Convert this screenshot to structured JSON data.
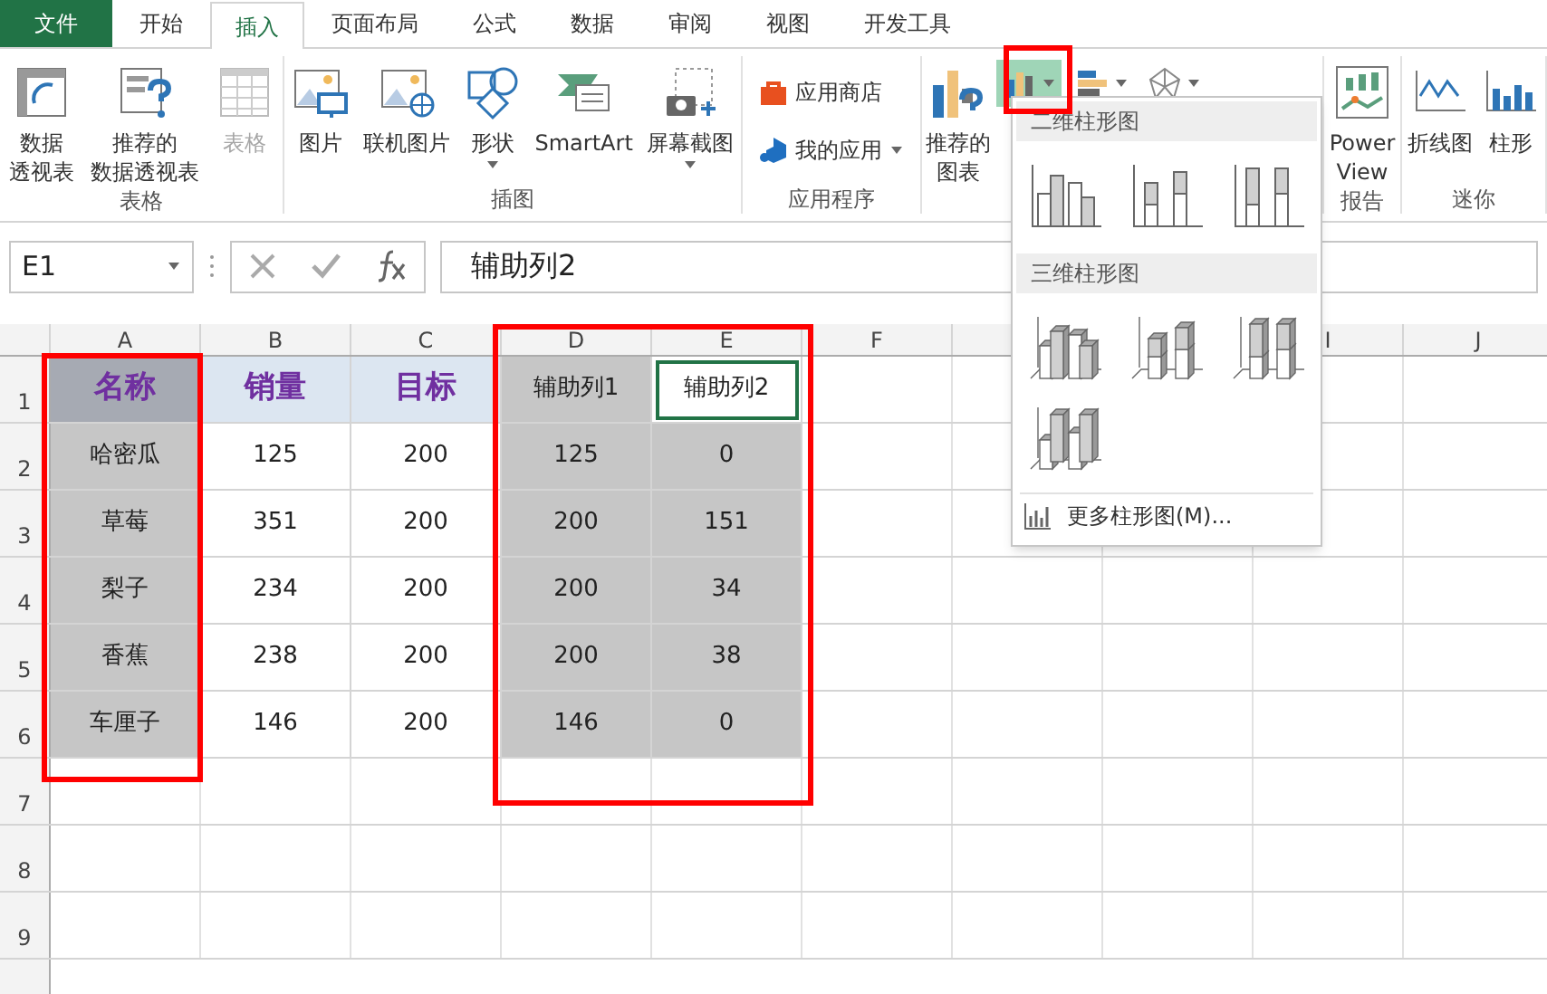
{
  "tabs": [
    {
      "label": "文件",
      "kind": "file",
      "selected": false
    },
    {
      "label": "开始",
      "kind": "tab",
      "selected": false
    },
    {
      "label": "插入",
      "kind": "tab",
      "selected": true
    },
    {
      "label": "页面布局",
      "kind": "tab",
      "selected": false
    },
    {
      "label": "公式",
      "kind": "tab",
      "selected": false
    },
    {
      "label": "数据",
      "kind": "tab",
      "selected": false
    },
    {
      "label": "审阅",
      "kind": "tab",
      "selected": false
    },
    {
      "label": "视图",
      "kind": "tab",
      "selected": false
    },
    {
      "label": "开发工具",
      "kind": "tab",
      "selected": false
    }
  ],
  "ribbon": [
    {
      "label": "表格",
      "buttons": [
        {
          "kind": "large",
          "lines": [
            "数据",
            "透视表"
          ],
          "disabled": false,
          "dropdown": false
        },
        {
          "kind": "large",
          "lines": [
            "推荐的",
            "数据透视表"
          ],
          "disabled": false,
          "dropdown": false
        },
        {
          "kind": "large",
          "lines": [
            "表格"
          ],
          "disabled": true,
          "dropdown": false
        }
      ]
    },
    {
      "label": "插图",
      "buttons": [
        {
          "kind": "large",
          "lines": [
            "图片"
          ],
          "disabled": false,
          "dropdown": false
        },
        {
          "kind": "large",
          "lines": [
            "联机图片"
          ],
          "disabled": false,
          "dropdown": false
        },
        {
          "kind": "large",
          "lines": [
            "形状"
          ],
          "disabled": false,
          "dropdown": true
        },
        {
          "kind": "large",
          "lines": [
            "SmartArt"
          ],
          "disabled": false,
          "dropdown": false
        },
        {
          "kind": "large",
          "lines": [
            "屏幕截图"
          ],
          "disabled": false,
          "dropdown": true
        }
      ]
    },
    {
      "label": "应用程序",
      "buttons": [
        {
          "kind": "small",
          "lines": [
            "应用商店"
          ],
          "disabled": false,
          "dropdown": false
        },
        {
          "kind": "small",
          "lines": [
            "我的应用"
          ],
          "disabled": false,
          "dropdown": true
        }
      ]
    },
    {
      "buttons": [
        {
          "kind": "large",
          "lines": [
            "推荐的",
            "图表"
          ],
          "disabled": false,
          "dropdown": false
        },
        {
          "kind": "chartbar",
          "disabled": false,
          "dropdown": true
        },
        {
          "kind": "chartbar",
          "disabled": false,
          "dropdown": true
        },
        {
          "kind": "chartbar",
          "disabled": false,
          "dropdown": true
        }
      ]
    },
    {
      "label": "报告",
      "buttons": [
        {
          "kind": "large",
          "lines": [
            "Power",
            "View"
          ],
          "disabled": false,
          "dropdown": false
        }
      ]
    },
    {
      "label": "迷你",
      "buttons": [
        {
          "kind": "large",
          "lines": [
            "折线图"
          ],
          "disabled": false,
          "dropdown": false
        },
        {
          "kind": "large",
          "lines": [
            "柱形"
          ],
          "disabled": false,
          "dropdown": false
        }
      ]
    }
  ],
  "name_box": "E1",
  "formula": "辅助列2",
  "columns": [
    "A",
    "B",
    "C",
    "D",
    "E",
    "F",
    "I",
    "J"
  ],
  "rows": [
    {
      "label": "1",
      "cells": [
        {
          "text": "名称",
          "kind": "header-gray",
          "selected": false
        },
        {
          "text": "销量",
          "kind": "header-blue",
          "selected": false
        },
        {
          "text": "目标",
          "kind": "header-blue",
          "selected": false
        },
        {
          "text": "辅助列1",
          "kind": "shaded",
          "selected": false
        },
        {
          "text": "辅助列2",
          "kind": "plain",
          "selected": true
        }
      ]
    },
    {
      "label": "2",
      "cells": [
        {
          "text": "哈密瓜",
          "kind": "shaded",
          "selected": false
        },
        {
          "text": "125",
          "kind": "plain",
          "selected": false
        },
        {
          "text": "200",
          "kind": "plain",
          "selected": false
        },
        {
          "text": "125",
          "kind": "shaded",
          "selected": false
        },
        {
          "text": "0",
          "kind": "shaded",
          "selected": false
        }
      ]
    },
    {
      "label": "3",
      "cells": [
        {
          "text": "草莓",
          "kind": "shaded",
          "selected": false
        },
        {
          "text": "351",
          "kind": "plain",
          "selected": false
        },
        {
          "text": "200",
          "kind": "plain",
          "selected": false
        },
        {
          "text": "200",
          "kind": "shaded",
          "selected": false
        },
        {
          "text": "151",
          "kind": "shaded",
          "selected": false
        }
      ]
    },
    {
      "label": "4",
      "cells": [
        {
          "text": "梨子",
          "kind": "shaded",
          "selected": false
        },
        {
          "text": "234",
          "kind": "plain",
          "selected": false
        },
        {
          "text": "200",
          "kind": "plain",
          "selected": false
        },
        {
          "text": "200",
          "kind": "shaded",
          "selected": false
        },
        {
          "text": "34",
          "kind": "shaded",
          "selected": false
        }
      ]
    },
    {
      "label": "5",
      "cells": [
        {
          "text": "香蕉",
          "kind": "shaded",
          "selected": false
        },
        {
          "text": "238",
          "kind": "plain",
          "selected": false
        },
        {
          "text": "200",
          "kind": "plain",
          "selected": false
        },
        {
          "text": "200",
          "kind": "shaded",
          "selected": false
        },
        {
          "text": "38",
          "kind": "shaded",
          "selected": false
        }
      ]
    },
    {
      "label": "6",
      "cells": [
        {
          "text": "车厘子",
          "kind": "shaded",
          "selected": false
        },
        {
          "text": "146",
          "kind": "plain",
          "selected": false
        },
        {
          "text": "200",
          "kind": "plain",
          "selected": false
        },
        {
          "text": "146",
          "kind": "shaded",
          "selected": false
        },
        {
          "text": "0",
          "kind": "shaded",
          "selected": false
        }
      ]
    },
    {
      "label": "7",
      "cells": []
    },
    {
      "label": "8",
      "cells": []
    },
    {
      "label": "9",
      "cells": []
    }
  ],
  "dropdown": {
    "sections": [
      {
        "title": "二维柱形图",
        "items": [
          {
            "kind": "clustered"
          },
          {
            "kind": "stacked"
          },
          {
            "kind": "stacked100"
          }
        ]
      },
      {
        "title": "三维柱形图",
        "items": [
          {
            "kind": "clustered3d"
          },
          {
            "kind": "stacked3d"
          },
          {
            "kind": "stacked1003d"
          },
          {
            "kind": "column3d"
          }
        ]
      }
    ],
    "more": "更多柱形图(M)..."
  }
}
